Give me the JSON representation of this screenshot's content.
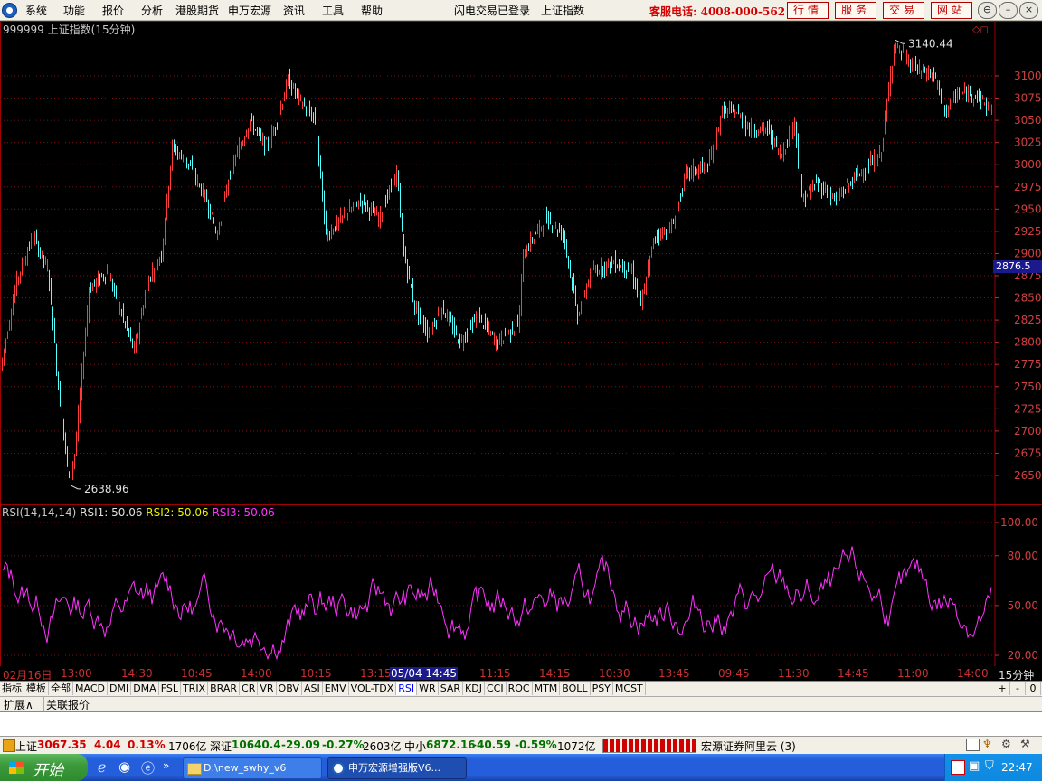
{
  "menu": {
    "items": [
      "系统",
      "功能",
      "报价",
      "分析",
      "港股期货",
      "申万宏源",
      "资讯",
      "工具",
      "帮助"
    ],
    "login_status": "闪电交易已登录",
    "current_index": "上证指数",
    "hotline": "客服电话: 4008-000-562",
    "buttons": [
      "行情",
      "服务",
      "交易",
      "网站"
    ]
  },
  "chart": {
    "title": "999999 上证指数(15分钟)",
    "high_label": "3140.44",
    "low_label": "2638.96",
    "current_price": "2876.5",
    "y_ticks": [
      "3100",
      "3075",
      "3050",
      "3025",
      "3000",
      "2975",
      "2950",
      "2925",
      "2900",
      "2875",
      "2850",
      "2825",
      "2800",
      "2775",
      "2750",
      "2725",
      "2700",
      "2675",
      "2650"
    ],
    "colors": {
      "up": "#ff3c3c",
      "down": "#54ffff",
      "rsi": "#ff33ff",
      "grid": "#7a1010"
    }
  },
  "rsi": {
    "label": "RSI(14,14,14)",
    "rsi1": "RSI1: 50.06",
    "rsi2": "RSI2: 50.06",
    "rsi3": "RSI3: 50.06",
    "y_ticks": [
      "100.00",
      "80.00",
      "50.00",
      "20.00"
    ]
  },
  "time_axis": {
    "labels": [
      "02月16日",
      "13:00",
      "14:30",
      "10:45",
      "14:00",
      "10:15",
      "13:15",
      "05/04 14:45",
      "11:15",
      "14:15",
      "10:30",
      "13:45",
      "09:45",
      "11:30",
      "14:45",
      "11:00",
      "14:00"
    ],
    "period": "15分钟"
  },
  "indicator_tabs": {
    "left": [
      "指标",
      "模板",
      "全部"
    ],
    "items": [
      "MACD",
      "DMI",
      "DMA",
      "FSL",
      "TRIX",
      "BRAR",
      "CR",
      "VR",
      "OBV",
      "ASI",
      "EMV",
      "VOL-TDX",
      "RSI",
      "WR",
      "SAR",
      "KDJ",
      "CCI",
      "ROC",
      "MTM",
      "BOLL",
      "PSY",
      "MCST"
    ],
    "active": "RSI",
    "right_buttons": [
      "+",
      "-",
      "0"
    ]
  },
  "expand_row": [
    "扩展∧",
    "关联报价"
  ],
  "status": {
    "sh_label": "上证",
    "sh_value": "3067.35",
    "sh_change": "4.04",
    "sh_pct": "0.13%",
    "sh_vol": "1706亿",
    "sz_label": "深证",
    "sz_value": "10640.4",
    "sz_change": "-29.09",
    "sz_pct": "-0.27%",
    "sz_vol": "2603亿",
    "zx_label": "中小",
    "zx_value": "6872.16",
    "zx_change": "-40.59",
    "zx_pct": "-0.59%",
    "zx_vol": "1072亿",
    "broker": "宏源证券阿里云 (3)"
  },
  "taskbar": {
    "start": "开始",
    "tasks": [
      "D:\\new_swhy_v6",
      "申万宏源增强版V6..."
    ],
    "clock": "22:47"
  }
}
